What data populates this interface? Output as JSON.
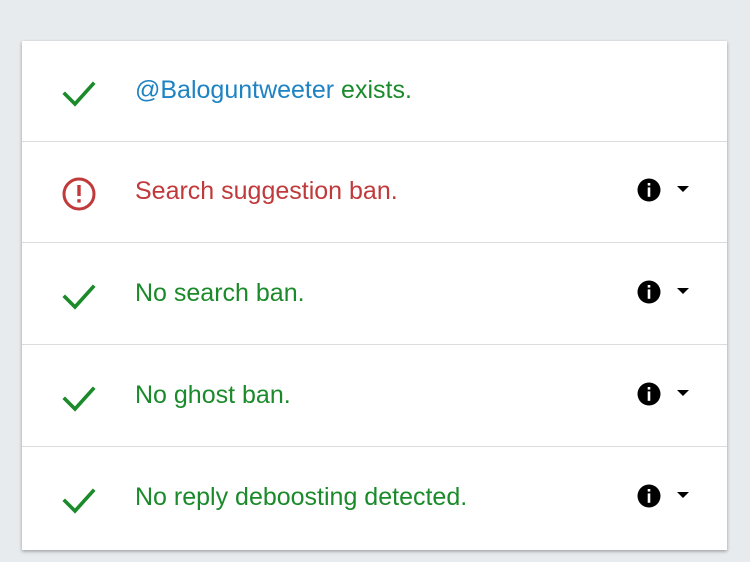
{
  "colors": {
    "ok": "#1b8a2a",
    "error": "#c0393b",
    "handle": "#1f83c3",
    "background": "#e8ebee"
  },
  "rows": [
    {
      "icon": "check-icon",
      "handle": "@Baloguntweeter",
      "text": " exists.",
      "status": "ok",
      "has_details": false
    },
    {
      "icon": "alert-circle-icon",
      "text": "Search suggestion ban.",
      "status": "error",
      "has_details": true
    },
    {
      "icon": "check-icon",
      "text": "No search ban.",
      "status": "ok",
      "has_details": true
    },
    {
      "icon": "check-icon",
      "text": "No ghost ban.",
      "status": "ok",
      "has_details": true
    },
    {
      "icon": "check-icon",
      "text": "No reply deboosting detected.",
      "status": "ok",
      "has_details": true
    }
  ]
}
